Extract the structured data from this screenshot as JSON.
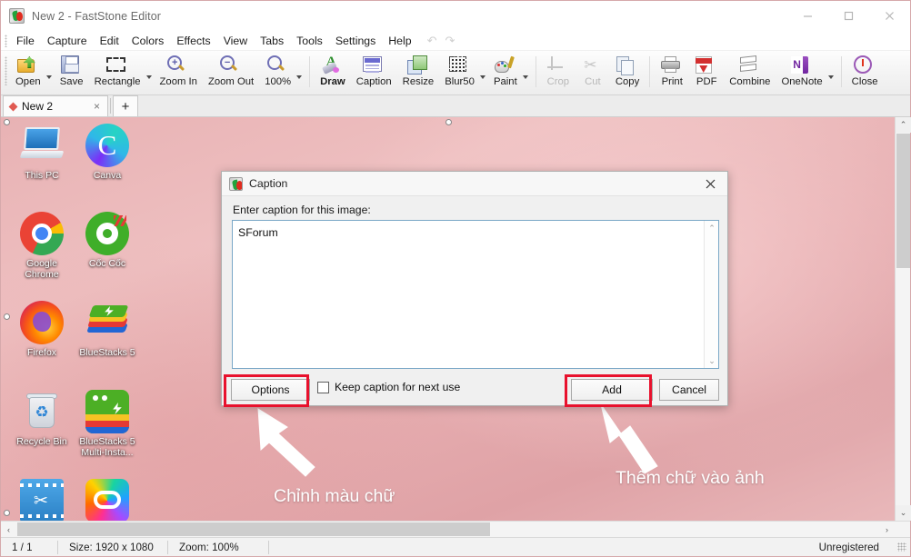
{
  "window": {
    "title": "New 2 - FastStone Editor",
    "app_icon": "faststone-logo-icon",
    "minimize_label": "─",
    "maximize_label": "☐",
    "close_label": "✕"
  },
  "menubar": {
    "items": [
      "File",
      "Capture",
      "Edit",
      "Colors",
      "Effects",
      "View",
      "Tabs",
      "Tools",
      "Settings",
      "Help"
    ],
    "undo_icon": "undo-icon",
    "redo_icon": "redo-icon"
  },
  "toolbar": {
    "items": [
      {
        "label": "Open",
        "icon": "open-folder-icon",
        "dropdown": true,
        "disabled": false,
        "bold": false
      },
      {
        "label": "Save",
        "icon": "save-disk-icon",
        "dropdown": false,
        "disabled": false,
        "bold": false
      },
      {
        "label": "Rectangle",
        "icon": "rectangle-select-icon",
        "dropdown": true,
        "disabled": false,
        "bold": false
      },
      {
        "label": "Zoom In",
        "icon": "zoom-in-icon",
        "dropdown": false,
        "disabled": false,
        "bold": false
      },
      {
        "label": "Zoom Out",
        "icon": "zoom-out-icon",
        "dropdown": false,
        "disabled": false,
        "bold": false
      },
      {
        "label": "100%",
        "icon": "zoom-100-icon",
        "dropdown": true,
        "disabled": false,
        "bold": false
      },
      {
        "label": "Draw",
        "icon": "draw-icon",
        "dropdown": false,
        "disabled": false,
        "bold": true
      },
      {
        "label": "Caption",
        "icon": "caption-icon",
        "dropdown": false,
        "disabled": false,
        "bold": false
      },
      {
        "label": "Resize",
        "icon": "resize-icon",
        "dropdown": false,
        "disabled": false,
        "bold": false
      },
      {
        "label": "Blur50",
        "icon": "blur-icon",
        "dropdown": true,
        "disabled": false,
        "bold": false
      },
      {
        "label": "Paint",
        "icon": "paint-icon",
        "dropdown": true,
        "disabled": false,
        "bold": false
      },
      {
        "label": "Crop",
        "icon": "crop-icon",
        "dropdown": false,
        "disabled": true,
        "bold": false
      },
      {
        "label": "Cut",
        "icon": "scissors-icon",
        "dropdown": false,
        "disabled": true,
        "bold": false
      },
      {
        "label": "Copy",
        "icon": "copy-icon",
        "dropdown": false,
        "disabled": false,
        "bold": false
      },
      {
        "label": "Print",
        "icon": "printer-icon",
        "dropdown": false,
        "disabled": false,
        "bold": false
      },
      {
        "label": "PDF",
        "icon": "pdf-icon",
        "dropdown": false,
        "disabled": false,
        "bold": false
      },
      {
        "label": "Combine",
        "icon": "combine-icon",
        "dropdown": false,
        "disabled": false,
        "bold": false
      },
      {
        "label": "OneNote",
        "icon": "onenote-icon",
        "dropdown": true,
        "disabled": false,
        "bold": false
      },
      {
        "label": "Close",
        "icon": "power-close-icon",
        "dropdown": false,
        "disabled": false,
        "bold": false
      }
    ]
  },
  "tabbar": {
    "tab_label": "New 2",
    "tab_close_label": "×",
    "add_tab_label": "+"
  },
  "desktop_icons": [
    {
      "label": "This PC",
      "icon": "this-pc-icon"
    },
    {
      "label": "Canva",
      "icon": "canva-icon"
    },
    {
      "label": "Google Chrome",
      "icon": "google-chrome-icon"
    },
    {
      "label": "Cốc Cốc",
      "icon": "coc-coc-icon"
    },
    {
      "label": "Firefox",
      "icon": "firefox-icon"
    },
    {
      "label": "BlueStacks 5",
      "icon": "bluestacks-icon"
    },
    {
      "label": "Recycle Bin",
      "icon": "recycle-bin-icon"
    },
    {
      "label": "BlueStacks 5 Multi-Insta...",
      "icon": "bluestacks-multi-icon"
    },
    {
      "label": "",
      "icon": "video-cutter-icon"
    },
    {
      "label": "",
      "icon": "creative-cloud-icon"
    }
  ],
  "dialog": {
    "title": "Caption",
    "icon": "faststone-logo-icon",
    "close_label": "✕",
    "prompt": "Enter caption for this image:",
    "caption_value": "SForum",
    "scroll_up_label": "⌃",
    "scroll_down_label": "⌄",
    "options_label": "Options",
    "keep_caption_label": "Keep caption for next use",
    "keep_caption_checked": false,
    "add_label": "Add",
    "cancel_label": "Cancel",
    "highlight_color": "#e8112d"
  },
  "annotations": [
    {
      "text": "Chỉnh màu chữ",
      "points_to": "options-button"
    },
    {
      "text": "Thêm chữ vào ảnh",
      "points_to": "add-button"
    }
  ],
  "statusbar": {
    "page": "1 / 1",
    "size": "Size: 1920 x 1080",
    "zoom": "Zoom: 100%",
    "registration": "Unregistered"
  },
  "scrollbars": {
    "up_label": "⌃",
    "down_label": "⌄",
    "left_label": "‹",
    "right_label": "›"
  }
}
